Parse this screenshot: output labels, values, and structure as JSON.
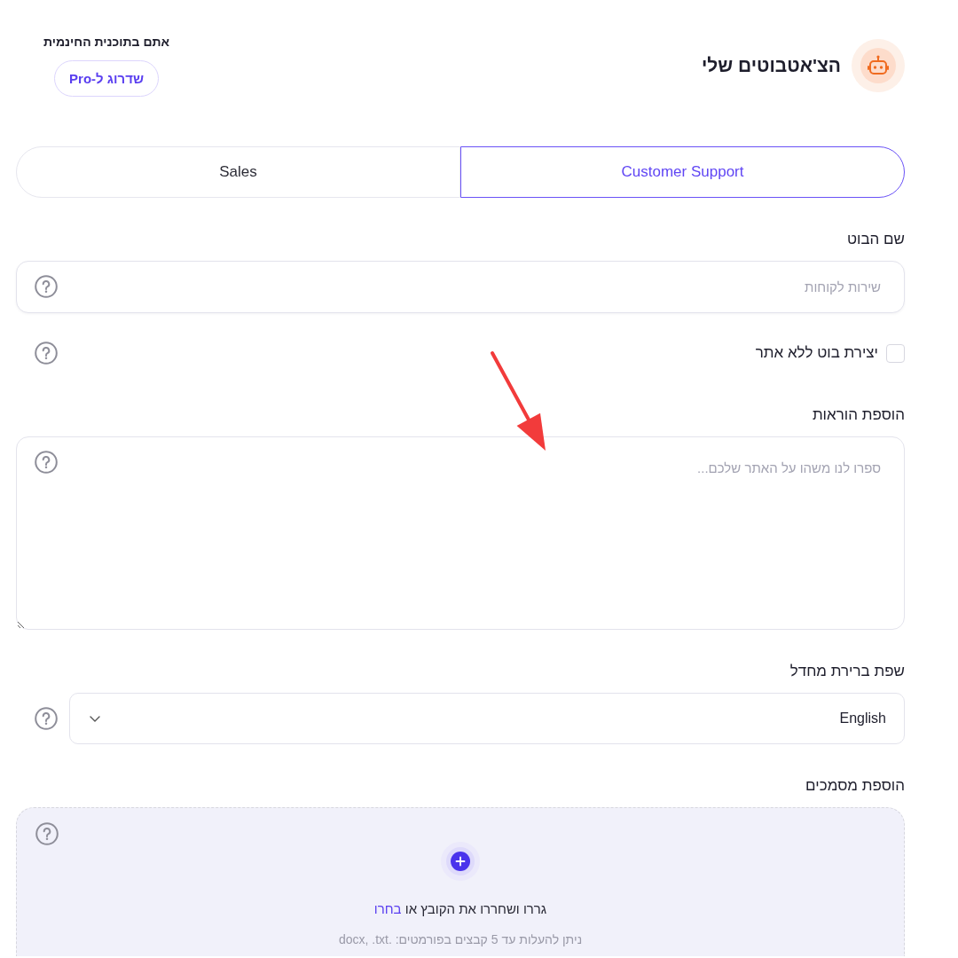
{
  "header": {
    "title": "הצ'אטבוטים שלי",
    "plan_note": "אתם בתוכנית החינמית",
    "upgrade_button": "שדרוג ל-Pro"
  },
  "tabs": [
    {
      "label": "Customer Support",
      "selected": true
    },
    {
      "label": "Sales",
      "selected": false
    }
  ],
  "fields": [
    {
      "kind": "text",
      "label": "שם הבוט",
      "placeholder": "שירות לקוחות"
    },
    {
      "kind": "checkbox",
      "label": "יצירת בוט ללא אתר",
      "checked": false
    },
    {
      "kind": "textarea",
      "label": "הוספת הוראות",
      "placeholder": "ספרו לנו משהו על האתר שלכם..."
    },
    {
      "kind": "select",
      "label": "שפת ברירת מחדל",
      "value": "English"
    },
    {
      "kind": "upload",
      "label": "הוספת מסמכים",
      "prompt": "גררו ושחררו את הקובץ או",
      "link": "בחרו",
      "hint": "ניתן להעלות עד 5 קבצים בפורמטים: .docx, .txt"
    }
  ]
}
